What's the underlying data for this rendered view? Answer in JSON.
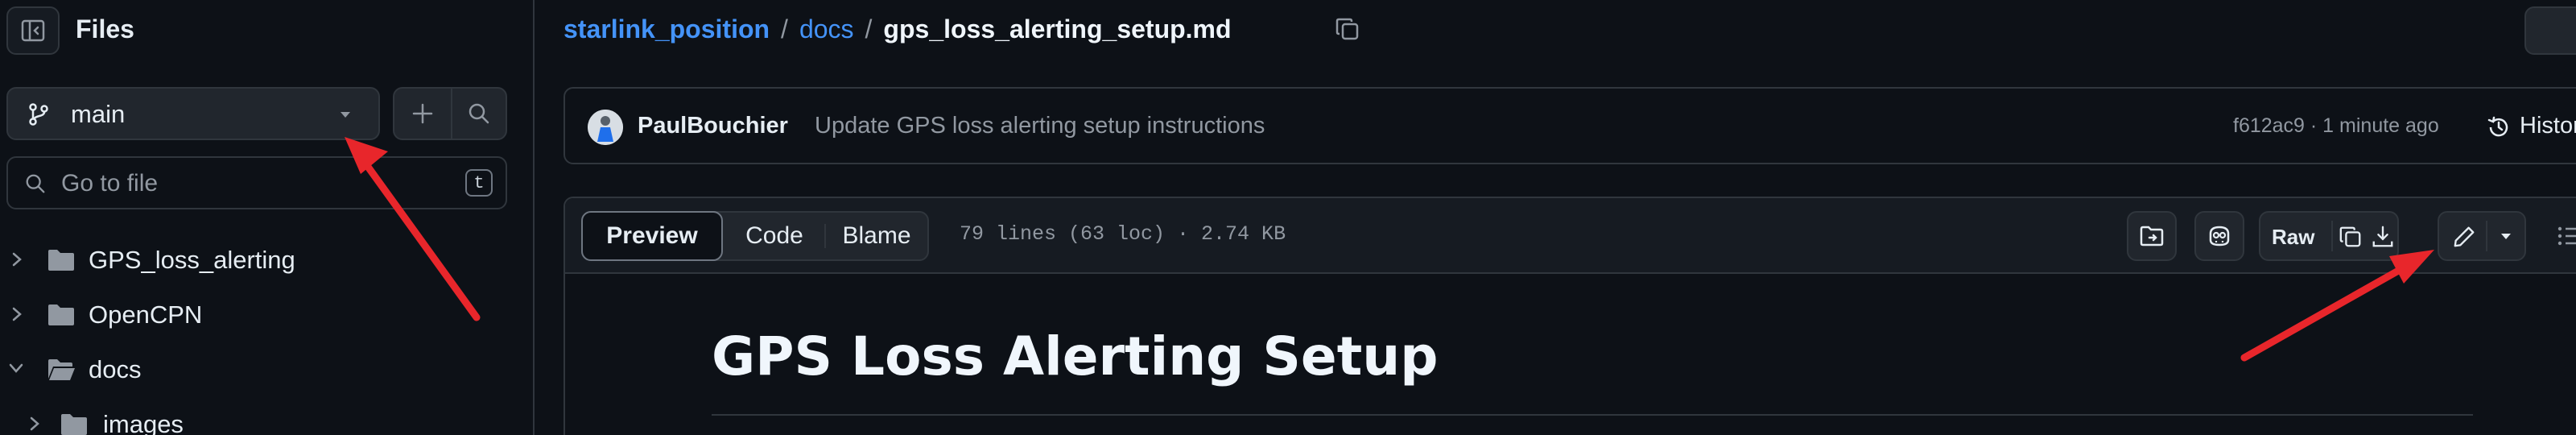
{
  "sidebar": {
    "title": "Files",
    "branch": "main",
    "search_placeholder": "Go to file",
    "search_shortcut": "t",
    "tree": [
      {
        "label": "GPS_loss_alerting",
        "type": "folder",
        "expanded": false,
        "level": 0
      },
      {
        "label": "OpenCPN",
        "type": "folder",
        "expanded": false,
        "level": 0
      },
      {
        "label": "docs",
        "type": "folder",
        "expanded": true,
        "level": 0
      },
      {
        "label": "images",
        "type": "folder",
        "expanded": false,
        "level": 1
      }
    ]
  },
  "breadcrumb": {
    "repo": "starlink_position",
    "folder": "docs",
    "separator": "/",
    "file": "gps_loss_alerting_setup.md"
  },
  "commit": {
    "author": "PaulBouchier",
    "message": "Update GPS loss alerting setup instructions",
    "meta": "f612ac9 · 1 minute ago",
    "history_label": "History"
  },
  "file_header": {
    "tabs": [
      "Preview",
      "Code",
      "Blame"
    ],
    "active_tab": "Preview",
    "info": "79 lines (63 loc) · 2.74 KB",
    "raw_label": "Raw"
  },
  "document": {
    "heading": "GPS Loss Alerting Setup"
  },
  "colors": {
    "background": "#0d1117",
    "border": "#30363d",
    "link": "#4493f8",
    "annotation_arrow": "#e8262b"
  }
}
